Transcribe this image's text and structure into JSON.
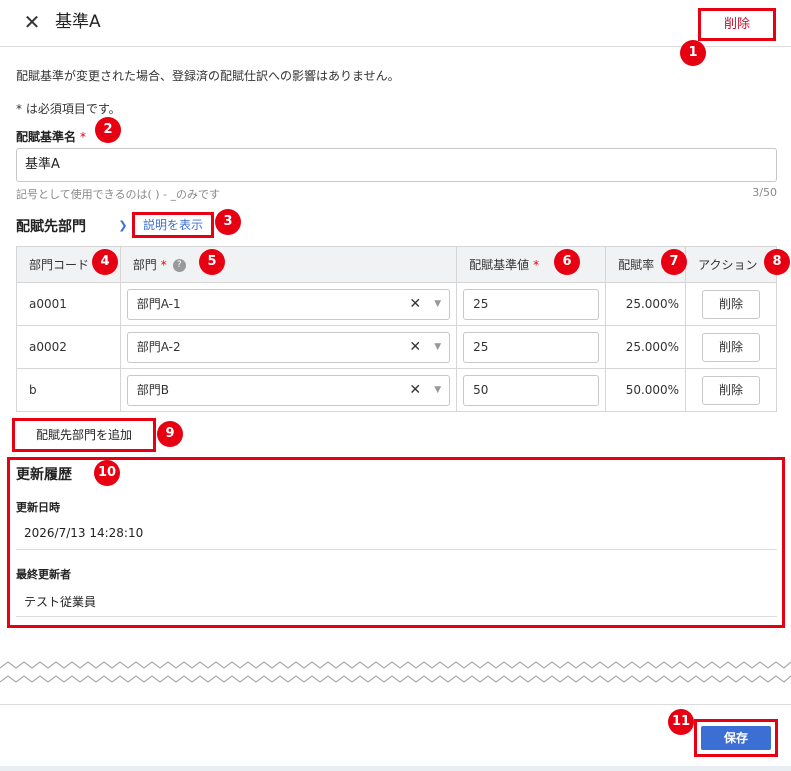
{
  "header": {
    "close_icon": "close-icon",
    "title": "基準A",
    "delete_label": "削除"
  },
  "form": {
    "notice": "配賦基準が変更された場合、登録済の配賦仕訳への影響はありません。",
    "required_note": "* は必須項目です。",
    "name_label": "配賦基準名",
    "required_mark": "*",
    "name_value": "基準A",
    "name_hint": "記号として使用できるのは( ) - _のみです",
    "name_counter": "3/50"
  },
  "departments": {
    "title": "配賦先部門",
    "toggle_icon": "chevron-down-icon",
    "show_desc": "説明を表示",
    "columns": {
      "code": "部門コード",
      "dept": "部門",
      "value": "配賦基準値",
      "rate": "配賦率",
      "action": "アクション"
    },
    "help_icon": "help-icon",
    "rows": [
      {
        "code": "a0001",
        "dept": "部門A-1",
        "value": "25",
        "rate": "25.000%",
        "action": "削除"
      },
      {
        "code": "a0002",
        "dept": "部門A-2",
        "value": "25",
        "rate": "25.000%",
        "action": "削除"
      },
      {
        "code": "b",
        "dept": "部門B",
        "value": "50",
        "rate": "50.000%",
        "action": "削除"
      }
    ],
    "add_label": "配賦先部門を追加"
  },
  "history": {
    "title": "更新履歴",
    "updated_at_label": "更新日時",
    "updated_at": "2026/7/13 14:28:10",
    "updated_by_label": "最終更新者",
    "updated_by": "テスト従業員"
  },
  "footer": {
    "save_label": "保存"
  },
  "badges": [
    "1",
    "2",
    "3",
    "4",
    "5",
    "6",
    "7",
    "8",
    "9",
    "10",
    "11"
  ],
  "colors": {
    "highlight": "#e60012",
    "primary": "#3b6fd4",
    "danger_text": "#c8102e"
  }
}
